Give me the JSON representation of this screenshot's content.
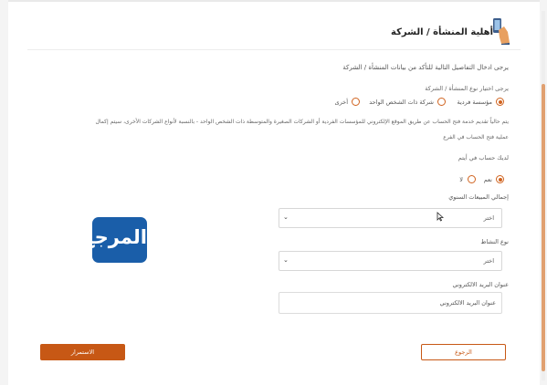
{
  "page": {
    "title": "أهلية المنشأة / الشركة",
    "instructions": "يرجى ادخال التفاصيل التالية للتأكد من بيانات المنشأة / الشركة"
  },
  "entity_type": {
    "question": "يرجى اختيار نوع المنشأة / الشركة",
    "options": [
      "مؤسسة فردية",
      "شركة ذات الشخص الواحد",
      "أخرى"
    ],
    "selected": "مؤسسة فردية"
  },
  "note": {
    "line1": "يتم حالياً تقديم خدمة فتح الحساب عن طريق الموقع الإلكتروني للمؤسسات الفردية أو الشركات الصغيرة والمتوسطة ذات الشخص الواحد - بالنسبة لأنواع الشركات الأخرى، سيتم إكمال",
    "line2": "عملية فتح الحساب في الفرع"
  },
  "has_account": {
    "question": "لديك حساب في أيتم",
    "options": [
      "نعم",
      "لا"
    ],
    "selected": "نعم"
  },
  "annual_sales": {
    "label": "إجمالي المبيعات السنوي",
    "value": "اختر"
  },
  "activity_type": {
    "label": "نوع النشاط",
    "value": "اختر"
  },
  "email": {
    "label": "عنوان البريد الالكتروني",
    "placeholder": "عنوان البريد الالكتروني"
  },
  "buttons": {
    "continue": "الاستمرار",
    "back": "الرجوع"
  },
  "watermark": {
    "text": "المرجع"
  },
  "colors": {
    "accent": "#c75815",
    "radio": "#d0631f",
    "watermark_bg": "#1a5ea9"
  }
}
